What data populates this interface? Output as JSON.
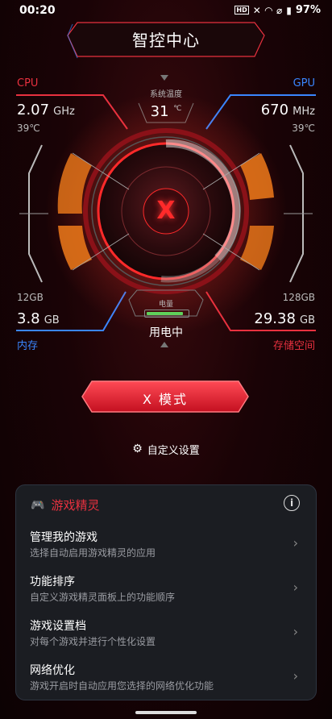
{
  "status": {
    "time": "00:20",
    "battery": "97%"
  },
  "header": {
    "title": "智控中心"
  },
  "cpu": {
    "label": "CPU",
    "freq_value": "2.07",
    "freq_unit": "GHz",
    "temp": "39℃"
  },
  "gpu": {
    "label": "GPU",
    "freq_value": "670",
    "freq_unit": "MHz",
    "temp": "39℃"
  },
  "memory": {
    "label": "内存",
    "total": "12GB",
    "used_value": "3.8",
    "used_unit": "GB"
  },
  "storage": {
    "label": "存储空间",
    "total": "128GB",
    "used_value": "29.38",
    "used_unit": "GB"
  },
  "system_temp": {
    "label": "系统温度",
    "value": "31",
    "unit": "℃"
  },
  "battery": {
    "label": "电量",
    "state": "用电中",
    "level": 0.9
  },
  "mode_button": {
    "label": "X 模式"
  },
  "custom_settings": {
    "label": "自定义设置"
  },
  "game_genie": {
    "title": "游戏精灵",
    "items": [
      {
        "title": "管理我的游戏",
        "desc": "选择自动启用游戏精灵的应用"
      },
      {
        "title": "功能排序",
        "desc": "自定义游戏精灵面板上的功能顺序"
      },
      {
        "title": "游戏设置档",
        "desc": "对每个游戏并进行个性化设置"
      },
      {
        "title": "网络优化",
        "desc": "游戏开启时自动应用您选择的网络优化功能"
      }
    ]
  },
  "colors": {
    "accent_red": "#e8313f",
    "accent_blue": "#3a86ff",
    "orange": "#f07a1a"
  }
}
